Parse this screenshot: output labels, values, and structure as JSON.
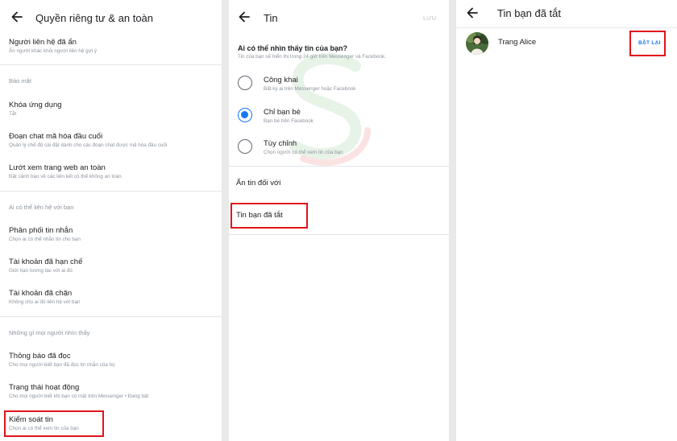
{
  "panel_privacy": {
    "title": "Quyền riêng tư & an toàn",
    "items": [
      {
        "label": "Người liên hệ đã ẩn",
        "sub": "Ẩn người khác khỏi người liên hệ gợi ý"
      },
      {
        "label": "Khóa ứng dụng",
        "sub": "Tắt"
      },
      {
        "label": "Đoạn chat mã hóa đầu cuối",
        "sub": "Quản lý chế độ cài đặt dành cho các đoạn chat được mã hóa đầu cuối"
      },
      {
        "label": "Lướt xem trang web an toàn",
        "sub": "Đặt cảnh báo về các liên kết có thể không an toàn"
      },
      {
        "label": "Phân phối tin nhắn",
        "sub": "Chọn ai có thể nhắn tin cho bạn"
      },
      {
        "label": "Tài khoản đã hạn chế",
        "sub": "Giới hạn tương tác với ai đó"
      },
      {
        "label": "Tài khoản đã chặn",
        "sub": "Không cho ai đó liên hệ với bạn"
      },
      {
        "label": "Thông báo đã đọc",
        "sub": "Cho mọi người biết bạn đã đọc tin nhắn của họ"
      },
      {
        "label": "Trạng thái hoạt động",
        "sub": "Cho mọi người biết khi bạn có mặt trên Messenger • Đang bật"
      },
      {
        "label": "Kiểm soát tin",
        "sub": "Chọn ai có thể xem tin của bạn"
      }
    ],
    "sections": [
      "Bảo mật",
      "Ai có thể liên hệ với bạn",
      "Những gì mọi người nhìn thấy"
    ]
  },
  "panel_story": {
    "title": "Tin",
    "save_label": "LƯU",
    "question": "Ai có thể nhìn thấy tin của bạn?",
    "question_sub": "Tin của bạn sẽ hiển thị trong 24 giờ trên Messenger và Facebook.",
    "options": [
      {
        "label": "Công khai",
        "sub": "Bất kỳ ai trên Messenger hoặc Facebook",
        "selected": false
      },
      {
        "label": "Chỉ bạn bè",
        "sub": "Bạn bè trên Facebook",
        "selected": true
      },
      {
        "label": "Tùy chỉnh",
        "sub": "Chọn người có thể xem tin của bạn",
        "selected": false
      }
    ],
    "hide_story_from": "Ẩn tin đối với",
    "muted_stories": "Tin bạn đã tắt",
    "accent_color": "#1877f2"
  },
  "panel_muted": {
    "title": "Tin bạn đã tắt",
    "contact_name": "Trang Alice",
    "unmute_label": "BẬT LẠI"
  },
  "highlight_color": "#e0141b"
}
